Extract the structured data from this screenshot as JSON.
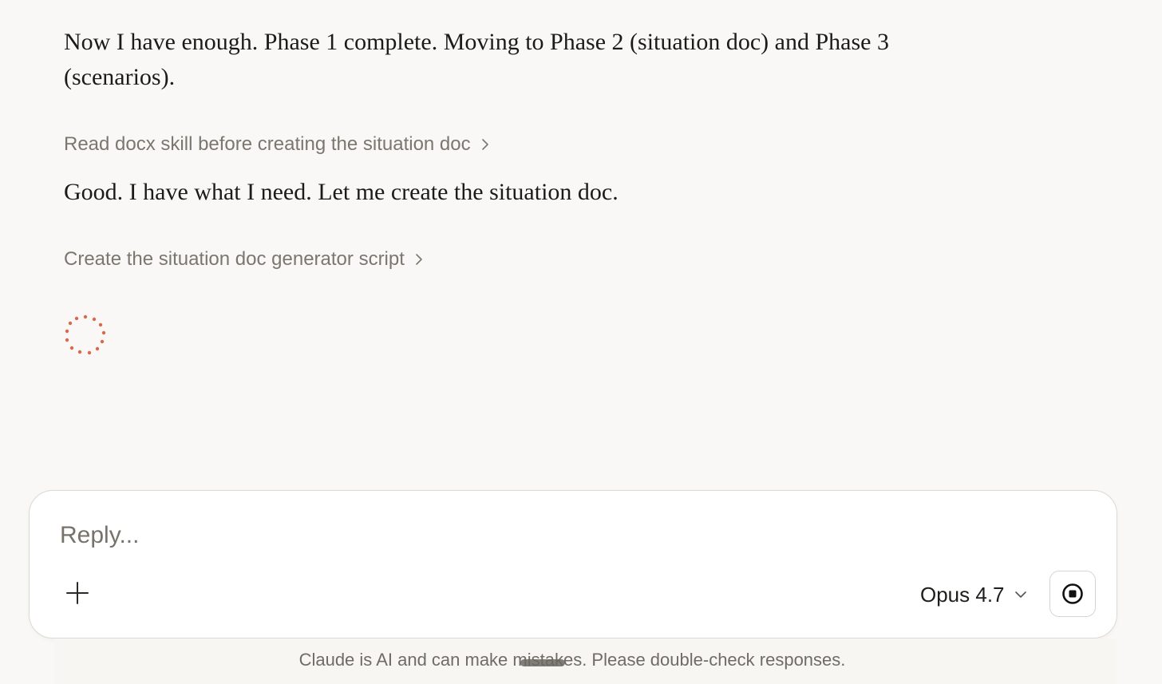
{
  "messages": [
    {
      "text": "Now I have enough. Phase 1 complete. Moving to Phase 2 (situation doc) and Phase 3 (scenarios)."
    },
    {
      "text": "Good. I have what I need. Let me create the situation doc."
    }
  ],
  "tool_steps": [
    {
      "label": "Read docx skill before creating the situation doc",
      "icon": "chevron-right-icon"
    },
    {
      "label": "Create the situation doc generator script",
      "icon": "chevron-right-icon"
    }
  ],
  "status": {
    "icon": "loading-spinner-icon",
    "color": "#d9694a"
  },
  "composer": {
    "placeholder": "Reply...",
    "value": "",
    "add_icon": "plus-icon",
    "model_label": "Opus 4.7",
    "model_icon": "chevron-down-icon",
    "stop_icon": "stop-icon"
  },
  "footer": {
    "disclaimer": "Claude is AI and can make mistakes. Please double-check responses."
  }
}
